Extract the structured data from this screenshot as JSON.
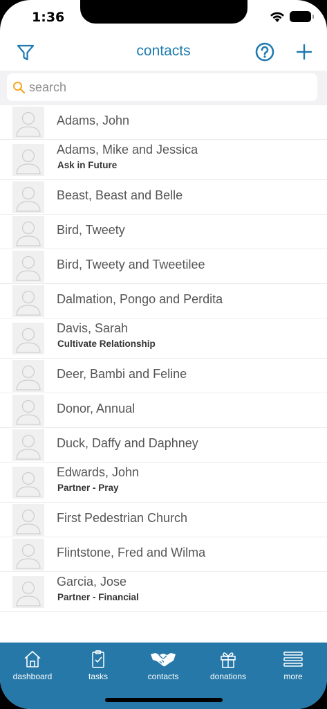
{
  "status": {
    "time": "1:36"
  },
  "nav": {
    "title": "contacts"
  },
  "search": {
    "placeholder": "search",
    "value": ""
  },
  "contacts": [
    {
      "name": "Adams, John",
      "status": ""
    },
    {
      "name": "Adams, Mike and Jessica",
      "status": "Ask in Future"
    },
    {
      "name": "Beast, Beast and Belle",
      "status": ""
    },
    {
      "name": "Bird, Tweety",
      "status": ""
    },
    {
      "name": "Bird, Tweety and Tweetilee",
      "status": ""
    },
    {
      "name": "Dalmation, Pongo and Perdita",
      "status": ""
    },
    {
      "name": "Davis, Sarah",
      "status": "Cultivate Relationship"
    },
    {
      "name": "Deer, Bambi and Feline",
      "status": ""
    },
    {
      "name": "Donor, Annual",
      "status": ""
    },
    {
      "name": "Duck, Daffy and Daphney",
      "status": ""
    },
    {
      "name": "Edwards, John",
      "status": "Partner - Pray"
    },
    {
      "name": "First Pedestrian Church",
      "status": ""
    },
    {
      "name": "Flintstone, Fred and Wilma",
      "status": ""
    },
    {
      "name": "Garcia, Jose",
      "status": "Partner - Financial"
    }
  ],
  "tabs": [
    {
      "label": "dashboard",
      "icon": "house-icon"
    },
    {
      "label": "tasks",
      "icon": "clipboard-icon"
    },
    {
      "label": "contacts",
      "icon": "handshake-icon"
    },
    {
      "label": "donations",
      "icon": "gift-icon"
    },
    {
      "label": "more",
      "icon": "menu-icon"
    }
  ],
  "colors": {
    "accent": "#1e7bb0",
    "tabbar": "#2678a8",
    "search_icon": "#f5a623"
  }
}
